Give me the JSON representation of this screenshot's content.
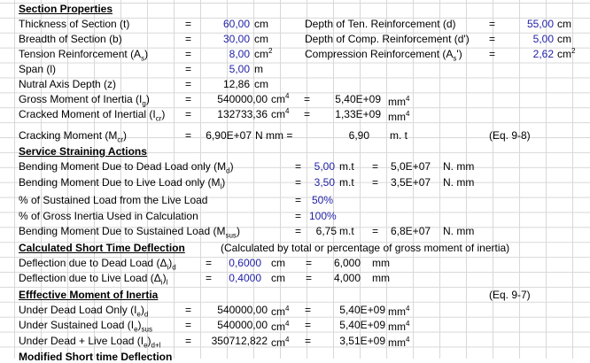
{
  "section_properties": {
    "title": "Section Properties",
    "rows": [
      {
        "label": "Thickness of Section (t)",
        "eq": "=",
        "value": "60,00",
        "unit": "cm"
      },
      {
        "label": "Breadth of Section (b)",
        "eq": "=",
        "value": "30,00",
        "unit": "cm"
      },
      {
        "label": "Tension Reinforcement (A",
        "sub": "s",
        "label_end": ")",
        "eq": "=",
        "value": "8,00",
        "unit": "cm",
        "unit_sup": "2"
      },
      {
        "label": "Span (l)",
        "eq": "=",
        "value": "5,00",
        "unit": "m"
      },
      {
        "label": "Nutral Axis Depth (z)",
        "eq": "=",
        "value": "12,86",
        "unit": "cm"
      }
    ],
    "right_rows": [
      {
        "label": "Depth of Ten. Reinforcement (d)",
        "eq": "=",
        "value": "55,00",
        "unit": "cm"
      },
      {
        "label": "Depth of Comp. Reinforcement (d')",
        "eq": "=",
        "value": "5,00",
        "unit": "cm"
      },
      {
        "label": "Compression Reinforcement (A",
        "sub": "s",
        "label_end": "')",
        "eq": "=",
        "value": "2,62",
        "unit": "cm",
        "unit_sup": "2"
      }
    ],
    "inertia_rows": [
      {
        "label": "Gross Moment of Inertia (I",
        "sub": "g",
        "label_end": ")",
        "eq": "=",
        "value": "540000,00",
        "unit": "cm",
        "unit_sup": "4",
        "eq2": "=",
        "value2": "5,40E+09",
        "unit2": "mm",
        "unit2_sup": "4"
      },
      {
        "label": "Cracked Moment of Inertial (I",
        "sub": "cr",
        "label_end": ")",
        "eq": "=",
        "value": "132733,36",
        "unit": "cm",
        "unit_sup": "4",
        "eq2": "=",
        "value2": "1,33E+09",
        "unit2": "mm",
        "unit2_sup": "4"
      },
      {
        "label": "Cracking Moment (M",
        "sub": "cr",
        "label_end": ")",
        "eq": "=",
        "value": "6,90E+07",
        "unit": "N mm =",
        "value2": "6,90",
        "unit2": "m. t",
        "ref": "(Eq. 9-8)"
      }
    ]
  },
  "service_actions": {
    "title": "Service Straining Actions",
    "rows": [
      {
        "label": "Bending Moment Due to Dead Load only (M",
        "sub": "d",
        "label_end": ")",
        "eq": "=",
        "value": "5,00",
        "unit": "m.t",
        "eq2": "=",
        "value2": "5,0E+07",
        "unit2": "N. mm"
      },
      {
        "label": "Bending Moment Due to Live Load only (M",
        "sub": "l",
        "label_end": ")",
        "eq": "=",
        "value": "3,50",
        "unit": "m.t",
        "eq2": "=",
        "value2": "3,5E+07",
        "unit2": "N. mm"
      },
      {
        "label": "% of Sustained Load from the Live Load",
        "eq": "=",
        "value": "50%"
      },
      {
        "label": "% of Gross Inertia Used in Calculation",
        "eq": "=",
        "value": "100%"
      },
      {
        "label": "Bending Moment Due to Sustained Load (M",
        "sub": "sus",
        "label_end": ")",
        "eq": "=",
        "value": "6,75",
        "unit": "m.t",
        "eq2": "=",
        "value2": "6,8E+07",
        "unit2": "N. mm"
      }
    ]
  },
  "short_deflection": {
    "title": "Calculated Short Time Deflection",
    "note": "(Calculated by total or percentage of gross moment of inertia)",
    "rows": [
      {
        "label": "Deflection due to Dead Load (Δ",
        "sub": "i",
        "label_end": ")",
        "sub2": "d",
        "eq": "=",
        "value": "0,6000",
        "unit": "cm",
        "eq2": "=",
        "value2": "6,000",
        "unit2": "mm"
      },
      {
        "label": "Deflection due to Live Load (Δ",
        "sub": "i",
        "label_end": ")",
        "sub2": "l",
        "eq": "=",
        "value": "0,4000",
        "unit": "cm",
        "eq2": "=",
        "value2": "4,000",
        "unit2": "mm"
      }
    ]
  },
  "effective_inertia": {
    "title": "Efffective Moment of Inertia",
    "ref": "(Eq. 9-7)",
    "rows": [
      {
        "label": "Under Dead Load Only (I",
        "sub": "e",
        "label_end": ")",
        "sub2": "d",
        "eq": "=",
        "value": "540000,00",
        "unit": "cm",
        "unit_sup": "4",
        "eq2": "=",
        "value2": "5,40E+09",
        "unit2": "mm",
        "unit2_sup": "4"
      },
      {
        "label": "Under Sustained Load (I",
        "sub": "e",
        "label_end": ")",
        "sub2": "sus",
        "eq": "=",
        "value": "540000,00",
        "unit": "cm",
        "unit_sup": "4",
        "eq2": "=",
        "value2": "5,40E+09",
        "unit2": "mm",
        "unit2_sup": "4"
      },
      {
        "label": "Under Dead + Live Load (I",
        "sub": "e",
        "label_end": ")",
        "sub2": "d+l",
        "eq": "=",
        "value": "350712,822",
        "unit": "cm",
        "unit_sup": "4",
        "eq2": "=",
        "value2": "3,51E+09",
        "unit2": "mm",
        "unit2_sup": "4"
      }
    ]
  },
  "next_section": {
    "title": "Modified Short time Deflection"
  }
}
